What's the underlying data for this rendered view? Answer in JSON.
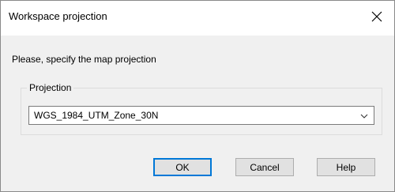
{
  "window": {
    "title": "Workspace projection",
    "close_icon": "close-icon"
  },
  "prompt": "Please, specify the map projection",
  "projection": {
    "group_label": "Projection",
    "selected": "WGS_1984_UTM_Zone_30N",
    "dropdown_icon": "chevron-down-icon"
  },
  "buttons": {
    "ok": "OK",
    "cancel": "Cancel",
    "help": "Help"
  },
  "colors": {
    "default_button_accent": "#0078d7"
  }
}
